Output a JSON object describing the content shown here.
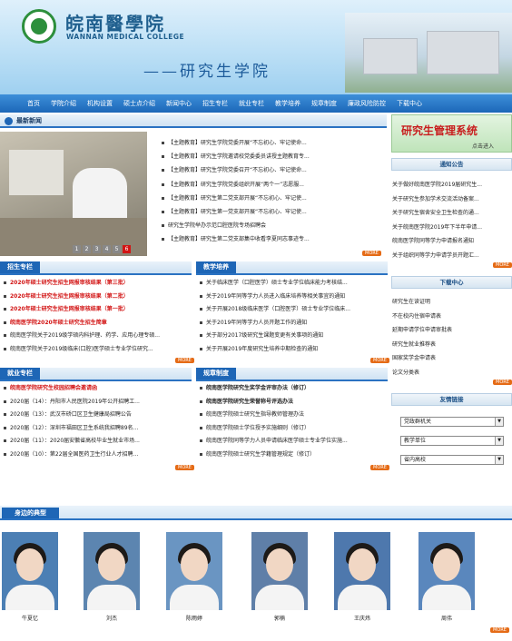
{
  "header": {
    "school_cn": "皖南醫學院",
    "school_en": "WANNAN MEDICAL COLLEGE",
    "subtitle": "——研究生学院"
  },
  "nav": [
    "首页",
    "学院介绍",
    "机构设置",
    "硕士点介绍",
    "新闻中心",
    "招生专栏",
    "就业专栏",
    "教学培养",
    "规章制度",
    "廉政风险防控",
    "下载中心"
  ],
  "latest_news": {
    "title": "最新新闻",
    "pager": [
      "1",
      "2",
      "3",
      "4",
      "5",
      "6"
    ],
    "items": [
      "【主题教育】研究生学院党委开展“不忘初心、牢记使命...",
      "【主题教育】研究生学院邀请校党委委员讲授主题教育专...",
      "【主题教育】研究生学院党委召开“不忘初心、牢记使命...",
      "【主题教育】研究生学院党委组织开展“两个一”志愿服...",
      "【主题教育】研究生第二党支部开展“不忘初心、牢记使...",
      "【主题教育】研究生第一党支部开展“不忘初心、牢记使...",
      "研究生学院举办示范口腔医院专场招聘会",
      "【主题教育】研究生第二党支部集中收看李夏同志事迹专..."
    ],
    "more": "MORE"
  },
  "admission": {
    "title": "招生专栏",
    "items": [
      "2020年硕士研究生招生网报审核结果（第三批）",
      "2020年硕士研究生招生网报审核结果（第二批）",
      "2020年硕士研究生招生网报审核结果（第一批）",
      "皖南医学院2020年硕士研究生招生简章",
      "皖南医学院关于2019级学硕内科护理、药学、应用心理专硕...",
      "皖南医学院关于2019级临床(口腔)医学硕士专业学位研究..."
    ],
    "red_count": 4,
    "more": "MORE"
  },
  "teaching": {
    "title": "教学培养",
    "items": [
      "关于临床医学（口腔医学）硕士专业学位临床能力考核结...",
      "关于2019年同等学力人员进入临床培养等相关事宜的通知",
      "关于开展2018级临床医学（口腔医学）硕士专业学位临床...",
      "关于2019年同等学力人员开题工作的通知",
      "关于部分2017级研究生课题变更有关事项的通知",
      "关于开展2019年度研究生培养中期检查的通知"
    ],
    "more": "MORE"
  },
  "employment": {
    "title": "就业专栏",
    "items": [
      "皖南医学院研究生校园招聘会邀请函",
      "2020届（14）：丹阳市人民医院2019年公开招聘工...",
      "2020届（13）：武汉市硚口区卫生健康局招聘公告",
      "2020届（12）：深圳市福田区卫生系统我招聘89名...",
      "2020届（11）：2020届安徽省高校毕业生就业市场...",
      "2020届（10）：第22届全国医药卫生行业人才招聘..."
    ],
    "red_count": 1,
    "more": "MORE"
  },
  "rules": {
    "title": "规章制度",
    "items": [
      "皖南医学院研究生奖学金评审办法（修订）",
      "皖南医学院研究生荣誉称号评选办法",
      "皖南医学院硕士研究生指导教师管理办法",
      "皖南医学院硕士学位授予实施细则（修订）",
      "皖南医学院同等学力人员申请临床医学硕士专业学位实施...",
      "皖南医学院硕士研究生学籍管理规定（修订）"
    ],
    "bold_count": 2,
    "more": "MORE"
  },
  "sidebar": {
    "system_banner": "研究生管理系统",
    "system_link": "点击进入",
    "notice_title": "通知公告",
    "notices": [
      "关于做好皖南医学院2019届研究生...",
      "关于研究生参加学术交流活动备案...",
      "关于研究生宿舍安全卫生检查的通...",
      "关于皖南医学院2019年下半年申请...",
      "皖南医学院同等学力申请报名通知",
      "关于组织同等学力申请学员开题汇..."
    ],
    "download_title": "下载中心",
    "downloads": [
      "研究生在读证明",
      "不在校内住宿申请表",
      "延期申请学位申请审批表",
      "研究生就业推荐表",
      "国家奖学金申请表",
      "论文分类表"
    ],
    "links_title": "友情链接",
    "selects": [
      "党政群机关",
      "教学单位",
      "省内高校"
    ],
    "more": "MORE"
  },
  "models": {
    "title": "身边的典型",
    "people": [
      "牛夏忆",
      "刘杰",
      "陈雨婷",
      "郭楠",
      "王庆炜",
      "周伟"
    ],
    "more": "MORE"
  },
  "colors": {
    "nav_blue": "#1c67b8",
    "accent_red": "#d21414",
    "more_orange": "#e56b16"
  }
}
